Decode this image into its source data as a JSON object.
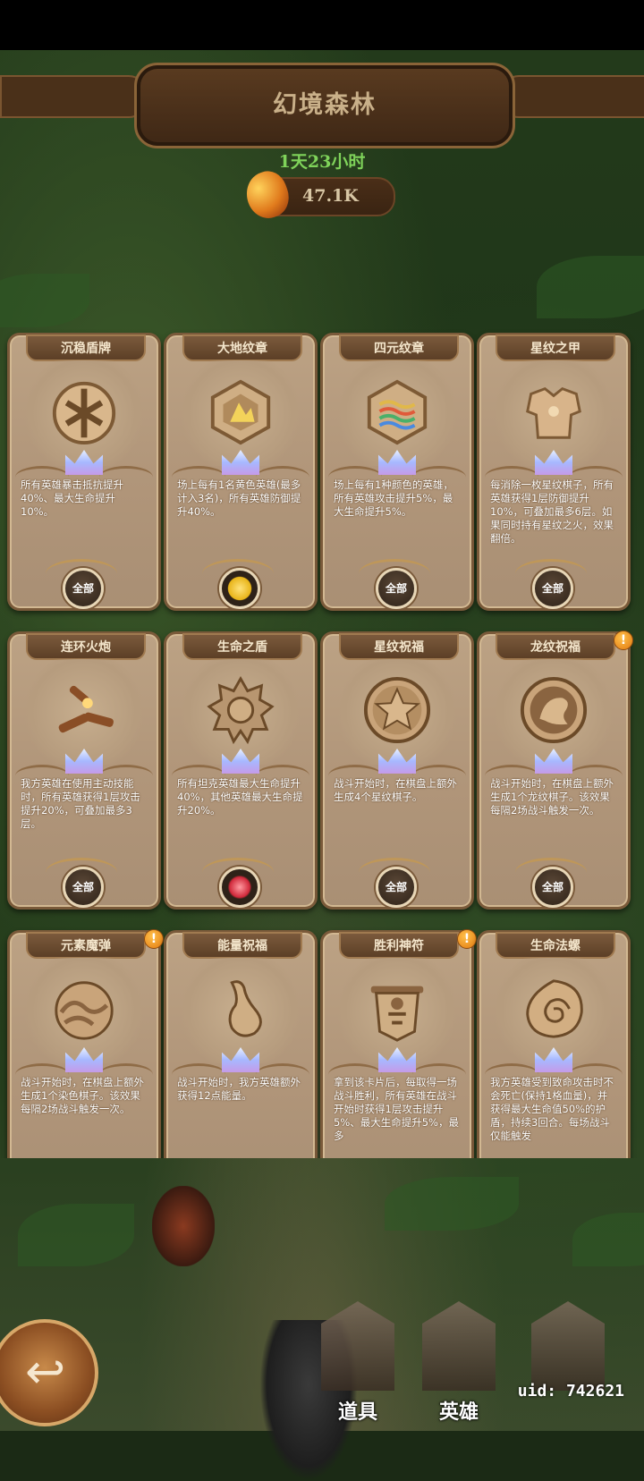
{
  "header": {
    "title": "幻境森林",
    "timer": "1天23小时",
    "resource_value": "47.1K"
  },
  "cards": [
    {
      "title": "沉稳盾牌",
      "icon": "shield-icon",
      "desc": "所有英雄暴击抵抗提升40%、最大生命提升10%。",
      "badge": "全部",
      "badge_type": "all",
      "alert": false
    },
    {
      "title": "大地纹章",
      "icon": "earth-emblem-icon",
      "desc": "场上每有1名黄色英雄(最多计入3名)，所有英雄防御提升40%。",
      "badge": "",
      "badge_type": "yellow",
      "alert": false
    },
    {
      "title": "四元纹章",
      "icon": "four-element-emblem-icon",
      "desc": "场上每有1种颜色的英雄，所有英雄攻击提升5%，最大生命提升5%。",
      "badge": "全部",
      "badge_type": "all",
      "alert": false
    },
    {
      "title": "星纹之甲",
      "icon": "star-armor-icon",
      "desc": "每消除一枚星纹棋子，所有英雄获得1层防御提升10%，可叠加最多6层。如果同时持有星纹之火，效果翻倍。",
      "badge": "全部",
      "badge_type": "all",
      "alert": false
    },
    {
      "title": "连环火炮",
      "icon": "cannon-icon",
      "desc": "我方英雄在使用主动技能时，所有英雄获得1层攻击提升20%，可叠加最多3层。",
      "badge": "全部",
      "badge_type": "all",
      "alert": false
    },
    {
      "title": "生命之盾",
      "icon": "spiked-shield-icon",
      "desc": "所有坦克英雄最大生命提升40%，其他英雄最大生命提升20%。",
      "badge": "",
      "badge_type": "red",
      "alert": false
    },
    {
      "title": "星纹祝福",
      "icon": "star-medal-icon",
      "desc": "战斗开始时，在棋盘上额外生成4个星纹棋子。",
      "badge": "全部",
      "badge_type": "all",
      "alert": false
    },
    {
      "title": "龙纹祝福",
      "icon": "dragon-medal-icon",
      "desc": "战斗开始时，在棋盘上额外生成1个龙纹棋子。该效果每隔2场战斗触发一次。",
      "badge": "全部",
      "badge_type": "all",
      "alert": true
    },
    {
      "title": "元素魔弹",
      "icon": "element-orb-icon",
      "desc": "战斗开始时，在棋盘上额外生成1个染色棋子。该效果每隔2场战斗触发一次。",
      "badge": "",
      "badge_type": "none",
      "alert": true
    },
    {
      "title": "能量祝福",
      "icon": "energy-gourd-icon",
      "desc": "战斗开始时，我方英雄额外获得12点能量。",
      "badge": "",
      "badge_type": "none",
      "alert": false
    },
    {
      "title": "胜利神符",
      "icon": "victory-banner-icon",
      "desc": "拿到该卡片后，每取得一场战斗胜利，所有英雄在战斗开始时获得1层攻击提升5%、最大生命提升5%，最多",
      "badge": "",
      "badge_type": "none",
      "alert": true
    },
    {
      "title": "生命法螺",
      "icon": "conch-shell-icon",
      "desc": "我方英雄受到致命攻击时不会死亡(保持1格血量)，并获得最大生命值50%的护盾，持续3回合。每场战斗仅能触发",
      "badge": "",
      "badge_type": "none",
      "alert": false
    }
  ],
  "alert_mark": "!",
  "nav": {
    "items_label": "道具",
    "heroes_label": "英雄"
  },
  "uid": "uid: 742621",
  "colors": {
    "timer_green": "#7fd35a",
    "card_bg": "#b1967a",
    "alert_orange": "#e27a10"
  }
}
